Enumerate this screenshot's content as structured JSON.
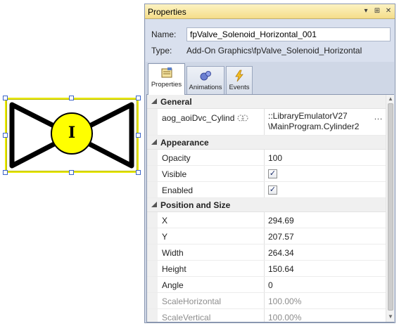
{
  "canvas": {
    "object_label": "I",
    "colors": {
      "selection": "#e8e800",
      "valve_fill": "#ffffff",
      "valve_stroke": "#000000",
      "actuator_fill": "#ffff00"
    }
  },
  "window": {
    "title": "Properties",
    "buttons": {
      "dropdown": "▾",
      "pin": "⊞",
      "close": "✕"
    }
  },
  "header": {
    "name_label": "Name:",
    "name_value": "fpValve_Solenoid_Horizontal_001",
    "type_label": "Type:",
    "type_value": "Add-On Graphics\\fpValve_Solenoid_Horizontal"
  },
  "tabs": [
    {
      "label": "Properties",
      "icon": "properties-icon",
      "active": true
    },
    {
      "label": "Animations",
      "icon": "animations-icon",
      "active": false
    },
    {
      "label": "Events",
      "icon": "events-icon",
      "active": false
    }
  ],
  "categories": {
    "general": {
      "label": "General",
      "aoi": {
        "name": "aog_aoiDvc_Cylind",
        "value_line1": "::LibraryEmulatorV27",
        "value_line2": "\\MainProgram.Cylinder2",
        "button": "..."
      }
    },
    "appearance": {
      "label": "Appearance",
      "opacity": {
        "name": "Opacity",
        "value": "100"
      },
      "visible": {
        "name": "Visible",
        "checked": true,
        "mark": "✓"
      },
      "enabled": {
        "name": "Enabled",
        "checked": true,
        "mark": "✓"
      }
    },
    "position": {
      "label": "Position and Size",
      "x": {
        "name": "X",
        "value": "294.69"
      },
      "y": {
        "name": "Y",
        "value": "207.57"
      },
      "width": {
        "name": "Width",
        "value": "264.34"
      },
      "height": {
        "name": "Height",
        "value": "150.64"
      },
      "angle": {
        "name": "Angle",
        "value": "0"
      },
      "scale_h": {
        "name": "ScaleHorizontal",
        "value": "100.00%"
      },
      "scale_v": {
        "name": "ScaleVertical",
        "value": "100.00%"
      }
    }
  },
  "scrollbar": {
    "up": "▲",
    "down": "▼"
  }
}
